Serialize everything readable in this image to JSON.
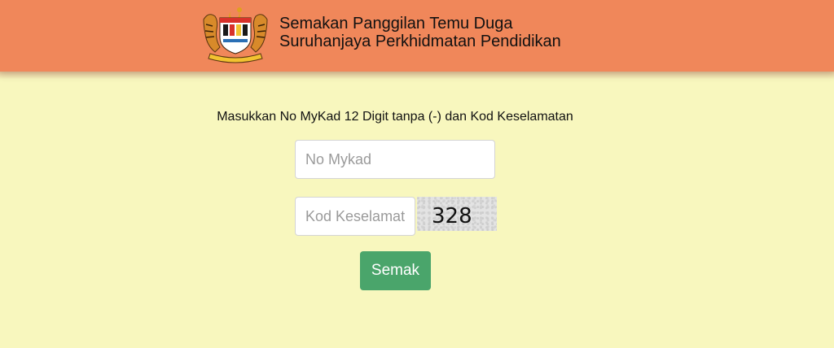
{
  "header": {
    "logo_icon": "jata-negara-crest-icon",
    "title_line1": "Semakan Panggilan Temu Duga",
    "title_line2": "Suruhanjaya Perkhidmatan Pendidikan",
    "background_color": "#f0875a"
  },
  "main": {
    "background_color": "#f8f7be",
    "instruction": "Masukkan No MyKad 12 Digit tanpa (-) dan Kod Keselamatan",
    "mykad_field": {
      "placeholder": "No Mykad",
      "value": ""
    },
    "kod_field": {
      "placeholder": "Kod Keselamatan",
      "value": ""
    },
    "captcha_code": "328",
    "submit_label": "Semak",
    "submit_color": "#4aa56b"
  }
}
